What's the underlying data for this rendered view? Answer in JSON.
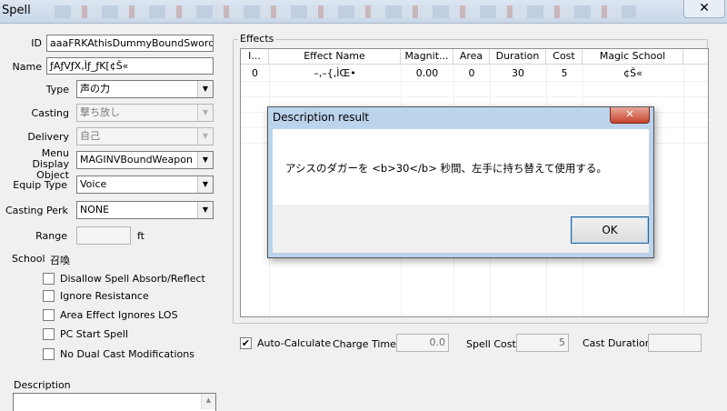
{
  "window": {
    "title": "Spell"
  },
  "form": {
    "id_label": "ID",
    "id_value": "aaaFRKAthisDummyBoundSwordShou",
    "name_label": "Name",
    "name_value": "ƒAƒVƒX‚Ìƒ_ƒK[¢Š«",
    "type_label": "Type",
    "type_value": "声の力",
    "casting_label": "Casting",
    "casting_value": "撃ち放し",
    "delivery_label": "Delivery",
    "delivery_value": "自己",
    "menu_display_label": "Menu Display Object",
    "menu_display_value": "MAGINVBoundWeapon",
    "equip_type_label": "Equip Type",
    "equip_type_value": "Voice",
    "casting_perk_label": "Casting Perk",
    "casting_perk_value": "NONE",
    "range_label": "Range",
    "range_unit": "ft",
    "school_label": "School",
    "school_value": "召喚",
    "checkboxes": [
      {
        "label": "Disallow Spell Absorb/Reflect",
        "checked": false
      },
      {
        "label": "Ignore Resistance",
        "checked": false
      },
      {
        "label": "Area Effect Ignores LOS",
        "checked": false
      },
      {
        "label": "PC Start Spell",
        "checked": false
      },
      {
        "label": "No Dual Cast Modifications",
        "checked": false
      }
    ],
    "description_label": "Description"
  },
  "effects": {
    "group_label": "Effects",
    "columns": [
      "I...",
      "Effect Name",
      "Magnit...",
      "Area",
      "Duration",
      "Cost",
      "Magic School"
    ],
    "rows": [
      {
        "index": "0",
        "effect_name": "–‚–{‚ÌŒ•",
        "magnitude": "0.00",
        "area": "0",
        "duration": "30",
        "cost": "5",
        "school": "¢Š«"
      }
    ]
  },
  "bottom": {
    "auto_calculate_label": "Auto-Calculate",
    "auto_calculate_checked": true,
    "check_mark": "✔",
    "charge_time_label": "Charge Time",
    "charge_time_value": "0.0",
    "spell_cost_label": "Spell Cost",
    "spell_cost_value": "5",
    "cast_duration_label": "Cast Duration",
    "cast_duration_value": ""
  },
  "dialog": {
    "title": "Description result",
    "message": "アシスのダガーを <b>30</b> 秒間、左手に持ち替えて使用する。",
    "ok_label": "OK",
    "close_glyph": "✕"
  },
  "icons": {
    "dropdown": "▼",
    "close": "✕",
    "scroll_up": "▲"
  }
}
